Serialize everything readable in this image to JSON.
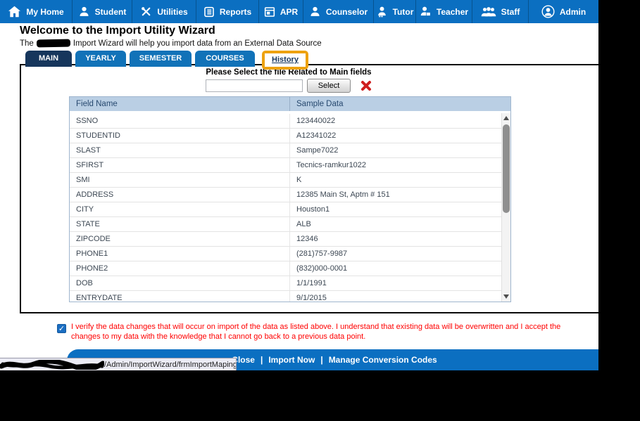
{
  "nav": {
    "items": [
      {
        "label": "My Home",
        "icon": "home-icon"
      },
      {
        "label": "Student",
        "icon": "student-icon"
      },
      {
        "label": "Utilities",
        "icon": "utilities-icon"
      },
      {
        "label": "Reports",
        "icon": "reports-icon"
      },
      {
        "label": "APR",
        "icon": "apr-icon"
      },
      {
        "label": "Counselor",
        "icon": "counselor-icon"
      },
      {
        "label": "Tutor",
        "icon": "tutor-icon"
      },
      {
        "label": "Teacher",
        "icon": "teacher-icon"
      },
      {
        "label": "Staff",
        "icon": "staff-icon"
      },
      {
        "label": "Admin",
        "icon": "admin-icon"
      }
    ]
  },
  "header": {
    "title": "Welcome to the Import Utility Wizard",
    "subtitle_prefix": "The",
    "subtitle_suffix": "Import Wizard will help you import data from an External Data Source"
  },
  "tabs": [
    {
      "label": "MAIN",
      "state": "active"
    },
    {
      "label": "YEARLY",
      "state": "normal"
    },
    {
      "label": "SEMESTER",
      "state": "normal"
    },
    {
      "label": "COURSES",
      "state": "normal"
    },
    {
      "label": "History",
      "state": "highlighted"
    }
  ],
  "file_select": {
    "prompt": "Please Select the file Related to Main fields",
    "input_value": "",
    "button_label": "Select"
  },
  "table": {
    "columns": [
      "Field Name",
      "Sample Data"
    ],
    "rows": [
      [
        "SSNO",
        "123440022"
      ],
      [
        "STUDENTID",
        "A12341022"
      ],
      [
        "SLAST",
        "Sampe7022"
      ],
      [
        "SFIRST",
        "Tecnics-ramkur1022"
      ],
      [
        "SMI",
        "K"
      ],
      [
        "ADDRESS",
        "12385 Main St, Aptm # 151"
      ],
      [
        "CITY",
        "Houston1"
      ],
      [
        "STATE",
        "ALB"
      ],
      [
        "ZIPCODE",
        "12346"
      ],
      [
        "PHONE1",
        "(281)757-9987"
      ],
      [
        "PHONE2",
        "(832)000-0001"
      ],
      [
        "DOB",
        "1/1/1991"
      ],
      [
        "ENTRYDATE",
        "9/1/2015"
      ]
    ]
  },
  "verify": {
    "checked": true,
    "checkmark": "✓",
    "text": "I verify the data changes that will occur on import of the data as listed above. I understand that existing data will be overwritten and I accept the changes to my data with the knowledge that I cannot go back to a previous data point."
  },
  "footer": {
    "links": [
      "Close",
      "Import Now",
      "Manage Conversion Codes"
    ],
    "separator": "|"
  },
  "status_bar": {
    "url": "/Admin/ImportWizard/frmImportMaping.aspx#"
  },
  "colors": {
    "nav_blue": "#0b6fc1",
    "tab_active_navy": "#16365c",
    "tab_blue": "#1172b8",
    "highlight_orange": "#eda211",
    "table_header_bg": "#bacfe4",
    "alert_red": "#ff0000",
    "footer_blue": "#0b6fc1"
  }
}
